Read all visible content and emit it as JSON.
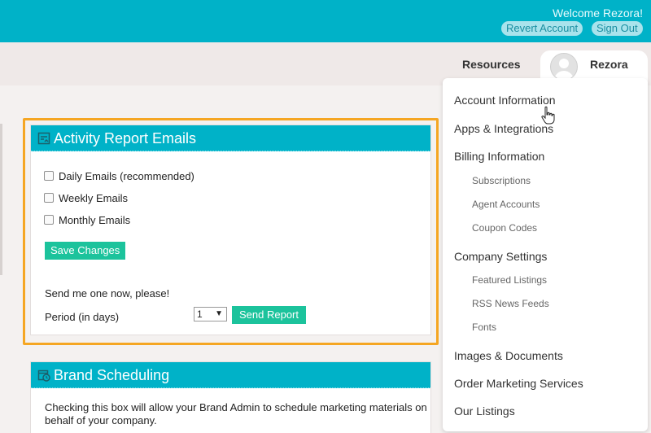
{
  "header": {
    "welcome": "Welcome Rezora!",
    "revert_account": "Revert Account",
    "sign_out": "Sign Out",
    "bg_color": "#00b2c8"
  },
  "nav": {
    "resources": "Resources",
    "username": "Rezora"
  },
  "activity_panel": {
    "title": "Activity Report Emails",
    "icon": "report-icon",
    "options": [
      {
        "label": "Daily Emails (recommended)",
        "checked": false
      },
      {
        "label": "Weekly Emails",
        "checked": false
      },
      {
        "label": "Monthly Emails",
        "checked": false
      }
    ],
    "save_label": "Save Changes",
    "send_now_text": "Send me one now, please!",
    "period_label": "Period (in days)",
    "period_value": "1",
    "send_label": "Send Report",
    "highlight_color": "#f5a623",
    "button_color": "#1cc39c"
  },
  "brand_panel": {
    "title": "Brand Scheduling",
    "icon": "calendar-clock-icon",
    "description": "Checking this box will allow your Brand Admin to schedule marketing materials on behalf of your company."
  },
  "menu": {
    "items": [
      {
        "label": "Account Information"
      },
      {
        "label": "Apps & Integrations"
      },
      {
        "label": "Billing Information"
      },
      {
        "label": "Subscriptions"
      },
      {
        "label": "Agent Accounts"
      },
      {
        "label": "Coupon Codes"
      },
      {
        "label": "Company Settings"
      },
      {
        "label": "Featured Listings"
      },
      {
        "label": "RSS News Feeds"
      },
      {
        "label": "Fonts"
      },
      {
        "label": "Images & Documents"
      },
      {
        "label": "Order Marketing Services"
      },
      {
        "label": "Our Listings"
      }
    ]
  }
}
